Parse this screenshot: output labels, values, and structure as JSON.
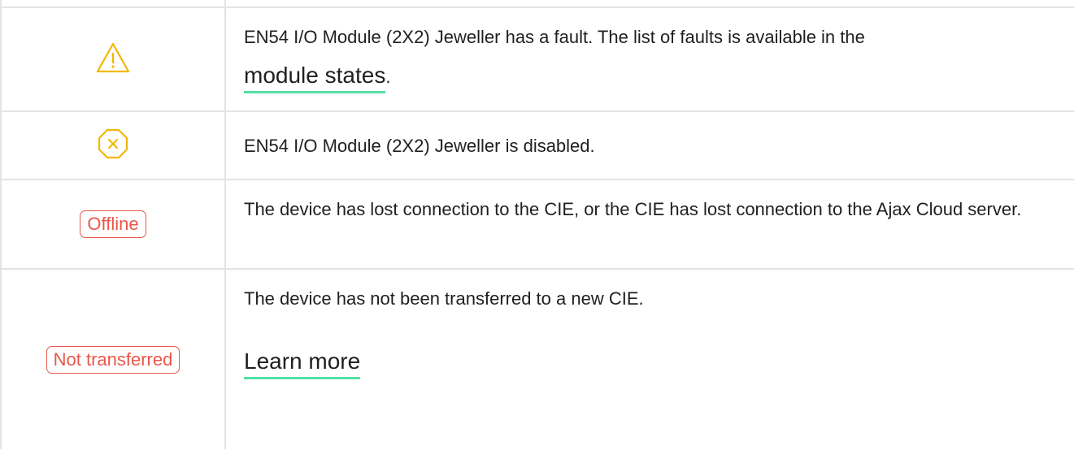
{
  "rows": [
    {
      "icon": "warning-triangle-icon",
      "text_before": "EN54 I/O Module (2X2) Jeweller has a fault. The list of faults is available in the",
      "link": "module states",
      "text_after": "."
    },
    {
      "icon": "disabled-octagon-x-icon",
      "text": "EN54 I/O Module (2X2) Jeweller is disabled."
    },
    {
      "badge": "Offline",
      "text": "The device has lost connection to the CIE, or the CIE has lost connection to the Ajax Cloud server."
    },
    {
      "badge": "Not transferred",
      "text": "The device has not been transferred to a new CIE.",
      "link": "Learn more"
    }
  ],
  "colors": {
    "icon_yellow": "#f2b705",
    "badge_red": "#e8574a",
    "link_underline": "#52e0a3",
    "border": "#e3e3e3"
  }
}
